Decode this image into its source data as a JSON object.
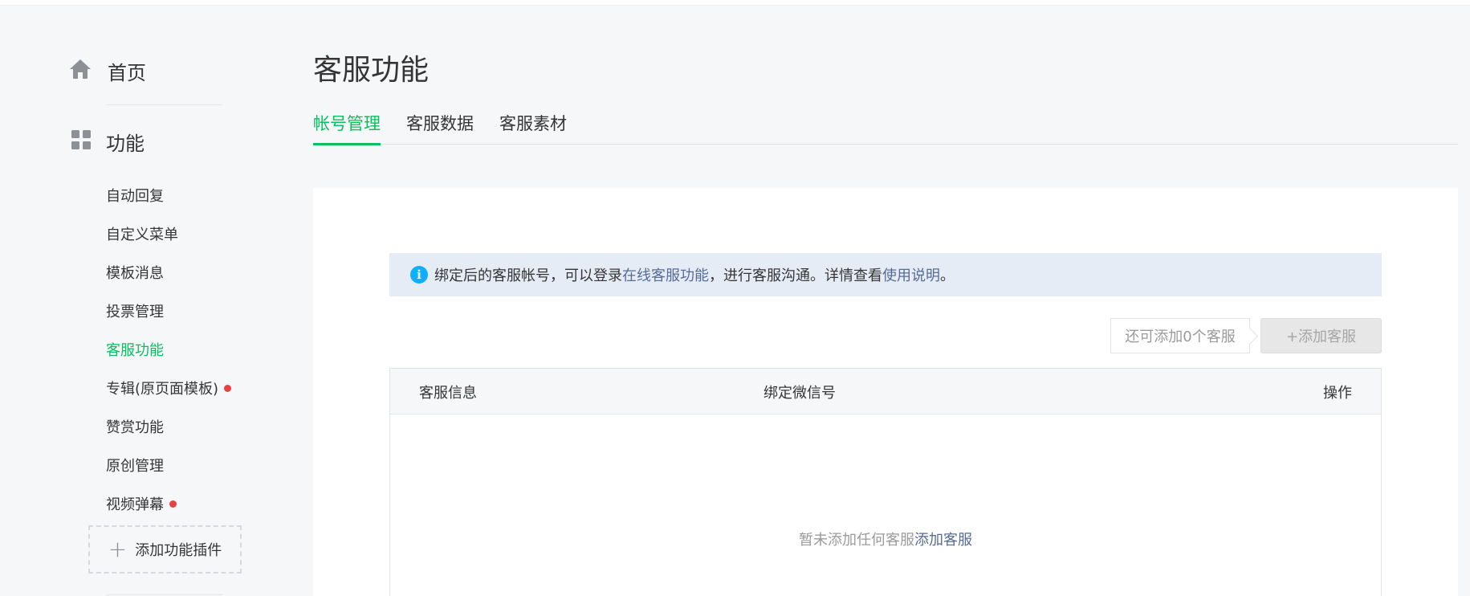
{
  "sidebar": {
    "home": {
      "label": "首页",
      "icon": "home-icon"
    },
    "functions": {
      "label": "功能",
      "icon": "grid-icon"
    },
    "items": [
      {
        "label": "自动回复",
        "active": false,
        "dot": false
      },
      {
        "label": "自定义菜单",
        "active": false,
        "dot": false
      },
      {
        "label": "模板消息",
        "active": false,
        "dot": false
      },
      {
        "label": "投票管理",
        "active": false,
        "dot": false
      },
      {
        "label": "客服功能",
        "active": true,
        "dot": false
      },
      {
        "label": "专辑(原页面模板)",
        "active": false,
        "dot": true
      },
      {
        "label": "赞赏功能",
        "active": false,
        "dot": false
      },
      {
        "label": "原创管理",
        "active": false,
        "dot": false
      },
      {
        "label": "视频弹幕",
        "active": false,
        "dot": true
      }
    ],
    "add_plugin_label": "添加功能插件"
  },
  "main": {
    "title": "客服功能",
    "tabs": [
      {
        "label": "帐号管理",
        "active": true
      },
      {
        "label": "客服数据",
        "active": false
      },
      {
        "label": "客服素材",
        "active": false
      }
    ],
    "notice": {
      "text_before": "绑定后的客服帐号，可以登录",
      "link1": "在线客服功能",
      "text_middle": "，进行客服沟通。详情查看",
      "link2": "使用说明",
      "text_after": "。"
    },
    "quota_text": "还可添加0个客服",
    "add_button_label": "+添加客服",
    "table": {
      "headers": [
        "客服信息",
        "绑定微信号",
        "操作"
      ],
      "empty_text": "暂未添加任何客服",
      "empty_link": "添加客服"
    }
  },
  "colors": {
    "accent": "#07c160",
    "link": "#576b95",
    "info": "#10aeff",
    "dot": "#e64340"
  }
}
